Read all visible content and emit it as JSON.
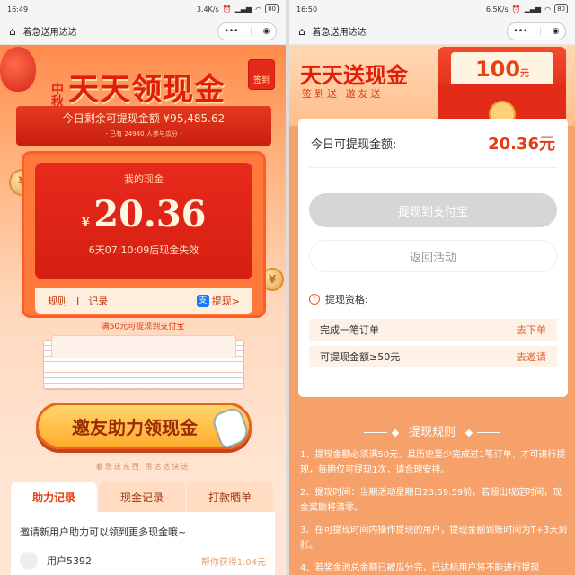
{
  "left": {
    "status": {
      "time": "16:49",
      "speed": "3.4K/s",
      "battery": "80"
    },
    "nav": {
      "title": "着急送用达达"
    },
    "header": {
      "badge_zhongqiu": "中秋",
      "title": "天天领现金",
      "sign_btn": "签到"
    },
    "ribbon": {
      "line1": "今日剩余可提现金额 ¥95,485.62",
      "line2": "- 已有 24940 人参与瓜分 -"
    },
    "cash": {
      "label": "我的现金",
      "currency": "¥",
      "amount": "20.36",
      "expire": "6天07:10:09后现金失效"
    },
    "links": {
      "rules": "规则",
      "separator": "I",
      "records": "记录",
      "alipay_icon": "支",
      "withdraw": "提现>"
    },
    "tip50": "满50元可提现到支付宝",
    "invite_btn": "邀友助力领现金",
    "slogan": "着急送东西 用达达快送",
    "tabs": [
      "助力记录",
      "现金记录",
      "打款晒单"
    ],
    "list": {
      "hint": "邀请新用户助力可以领到更多现金哦~",
      "user": "用户5392",
      "earned": "帮你获得1.04元"
    }
  },
  "right": {
    "status": {
      "time": "16:50",
      "speed": "6.5K/s",
      "battery": "80"
    },
    "nav": {
      "title": "着急送用达达"
    },
    "header": {
      "title": "天天送现金",
      "subtitle": "签到送  邀友送",
      "env_amount": "100",
      "env_unit": "元"
    },
    "today": {
      "label": "今日可提现金额:",
      "amount": "20.36元"
    },
    "btn_alipay": "提现到支付宝",
    "btn_back": "返回活动",
    "qual": {
      "icon": "!",
      "title": "提现资格:",
      "rows": [
        {
          "label": "完成一笔订单",
          "action": "去下单"
        },
        {
          "label": "可提现金额≥50元",
          "action": "去邀请"
        }
      ]
    },
    "rules_title": "提现规则",
    "rules": [
      "1、提现金额必须满50元，且历史至少完成过1笔订单，才可进行提现，每期仅可提现1次，请合理安排。",
      "2、提现时间：当期活动星期日23:59:59前，若超出规定时间，现金奖励将清零。",
      "3、在可提现时间内操作提现的用户，提现金额到账时间为T+3天到账。",
      "4、若奖金池总金额已被瓜分完，已达标用户将不能进行提现"
    ]
  }
}
